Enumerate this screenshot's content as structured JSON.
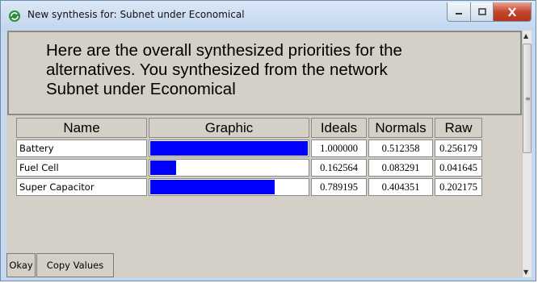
{
  "window": {
    "title": "New synthesis for: Subnet under Economical"
  },
  "header": {
    "lines": [
      "Here are the overall synthesized priorities for the",
      "alternatives.  You synthesized from the network",
      "Subnet under Economical"
    ]
  },
  "table": {
    "columns": [
      "Name",
      "Graphic",
      "Ideals",
      "Normals",
      "Raw"
    ],
    "rows": [
      {
        "name": "Battery",
        "ideal": "1.000000",
        "normal": "0.512358",
        "raw": "0.256179",
        "bar_fraction": 1.0
      },
      {
        "name": "Fuel Cell",
        "ideal": "0.162564",
        "normal": "0.083291",
        "raw": "0.041645",
        "bar_fraction": 0.162564
      },
      {
        "name": "Super Capacitor",
        "ideal": "0.789195",
        "normal": "0.404351",
        "raw": "0.202175",
        "bar_fraction": 0.789195
      }
    ],
    "bar_color": "#0000ff"
  },
  "buttons": {
    "okay": "Okay",
    "copy_values": "Copy Values"
  }
}
